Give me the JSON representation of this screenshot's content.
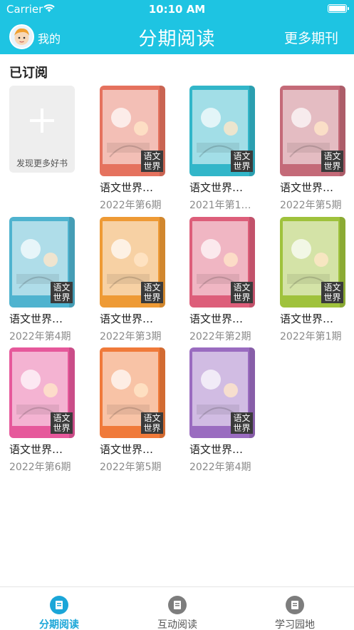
{
  "status": {
    "carrier": "Carrier",
    "time": "10:10 AM"
  },
  "nav": {
    "mine": "我的",
    "title": "分期阅读",
    "more": "更多期刊"
  },
  "section_title": "已订阅",
  "add_card": {
    "label": "发现更多好书"
  },
  "magazines": [
    {
      "title": "语文世界…",
      "issue": "2022年第6期",
      "color": "#e5725e",
      "badge": "语文\n世界"
    },
    {
      "title": "语文世界…",
      "issue": "2021年第1…",
      "color": "#32b6c9",
      "badge": "语文\n世界"
    },
    {
      "title": "语文世界…",
      "issue": "2022年第5期",
      "color": "#c46a78",
      "badge": "语文\n世界"
    },
    {
      "title": "语文世界…",
      "issue": "2022年第4期",
      "color": "#4fb3cf",
      "badge": "语文\n世界"
    },
    {
      "title": "语文世界…",
      "issue": "2022年第3期",
      "color": "#ee9a35",
      "badge": "语文\n世界"
    },
    {
      "title": "语文世界…",
      "issue": "2022年第2期",
      "color": "#dd5e7a",
      "badge": "语文\n世界"
    },
    {
      "title": "语文世界…",
      "issue": "2022年第1期",
      "color": "#9fc23c",
      "badge": "语文\n世界"
    },
    {
      "title": "语文世界…",
      "issue": "2022年第6期",
      "color": "#e6589b",
      "badge": "语文\n世界"
    },
    {
      "title": "语文世界…",
      "issue": "2022年第5期",
      "color": "#f07a3a",
      "badge": "语文\n世界"
    },
    {
      "title": "语文世界…",
      "issue": "2022年第4期",
      "color": "#9a6cc0",
      "badge": "语文\n世界"
    }
  ],
  "tabs": [
    {
      "label": "分期阅读",
      "active": true,
      "icon": "book-icon",
      "color": "#1ba6d8"
    },
    {
      "label": "互动阅读",
      "active": false,
      "icon": "chat-icon",
      "color": "#888888"
    },
    {
      "label": "学习园地",
      "active": false,
      "icon": "person-icon",
      "color": "#888888"
    }
  ]
}
